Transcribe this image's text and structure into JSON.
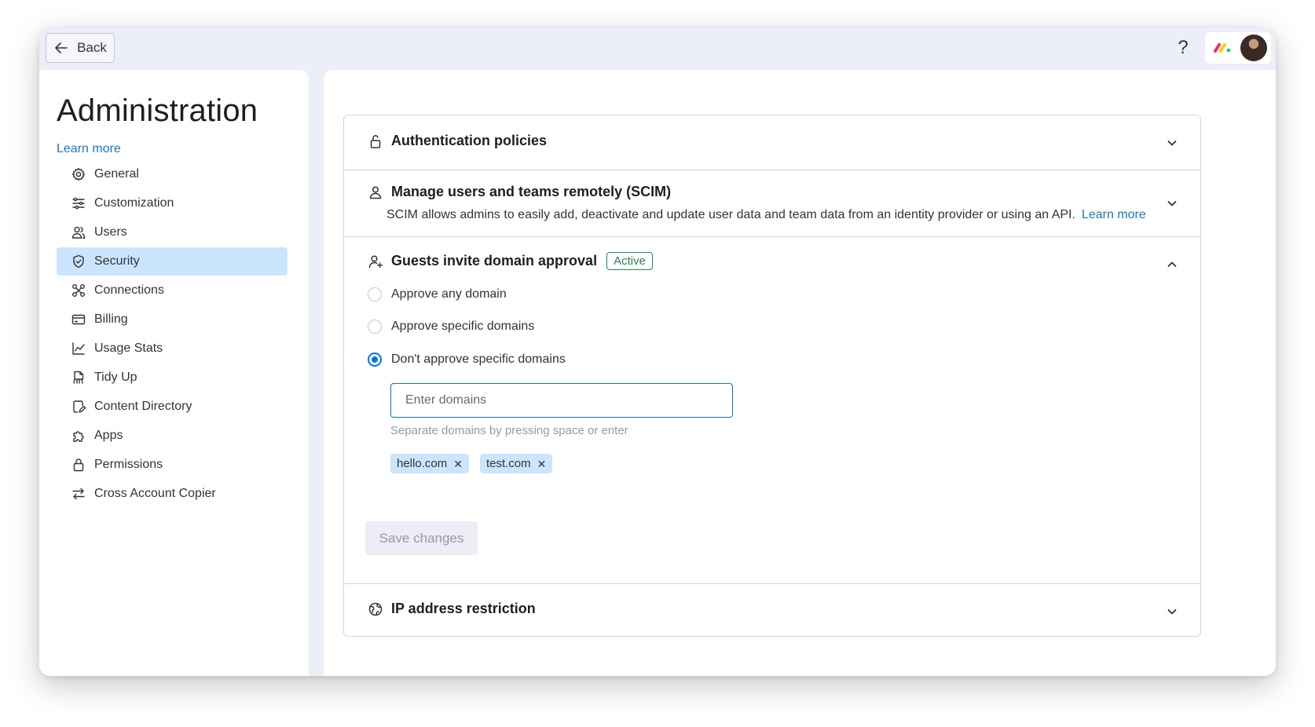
{
  "topbar": {
    "back_label": "Back",
    "help_label": "?"
  },
  "sidebar": {
    "title": "Administration",
    "learn_more": "Learn more",
    "items": [
      {
        "label": "General",
        "icon": "gear-icon"
      },
      {
        "label": "Customization",
        "icon": "sliders-icon"
      },
      {
        "label": "Users",
        "icon": "users-icon"
      },
      {
        "label": "Security",
        "icon": "shield-icon",
        "active": true
      },
      {
        "label": "Connections",
        "icon": "connections-icon"
      },
      {
        "label": "Billing",
        "icon": "billing-icon"
      },
      {
        "label": "Usage Stats",
        "icon": "chart-icon"
      },
      {
        "label": "Tidy Up",
        "icon": "tidy-icon"
      },
      {
        "label": "Content Directory",
        "icon": "content-icon"
      },
      {
        "label": "Apps",
        "icon": "puzzle-icon"
      },
      {
        "label": "Permissions",
        "icon": "lock-icon"
      },
      {
        "label": "Cross Account Copier",
        "icon": "swap-icon"
      }
    ]
  },
  "sections": {
    "auth": {
      "title": "Authentication policies"
    },
    "scim": {
      "title": "Manage users and teams remotely (SCIM)",
      "description": "SCIM allows admins to easily add, deactivate and update user data and team data from an identity provider or using an API.",
      "learn_more": "Learn more"
    },
    "guest": {
      "title": "Guests invite domain approval",
      "badge": "Active",
      "options": [
        {
          "label": "Approve any domain",
          "checked": false
        },
        {
          "label": "Approve specific domains",
          "checked": false
        },
        {
          "label": "Don't approve specific domains",
          "checked": true
        }
      ],
      "input_placeholder": "Enter domains",
      "hint": "Separate domains by pressing space or enter",
      "chips": [
        "hello.com",
        "test.com"
      ],
      "save_label": "Save changes"
    },
    "ip": {
      "title": "IP address restriction"
    }
  },
  "colors": {
    "accent": "#0073ea",
    "link": "#1f76c2",
    "active_nav": "#cce5ff",
    "badge": "#258750"
  }
}
